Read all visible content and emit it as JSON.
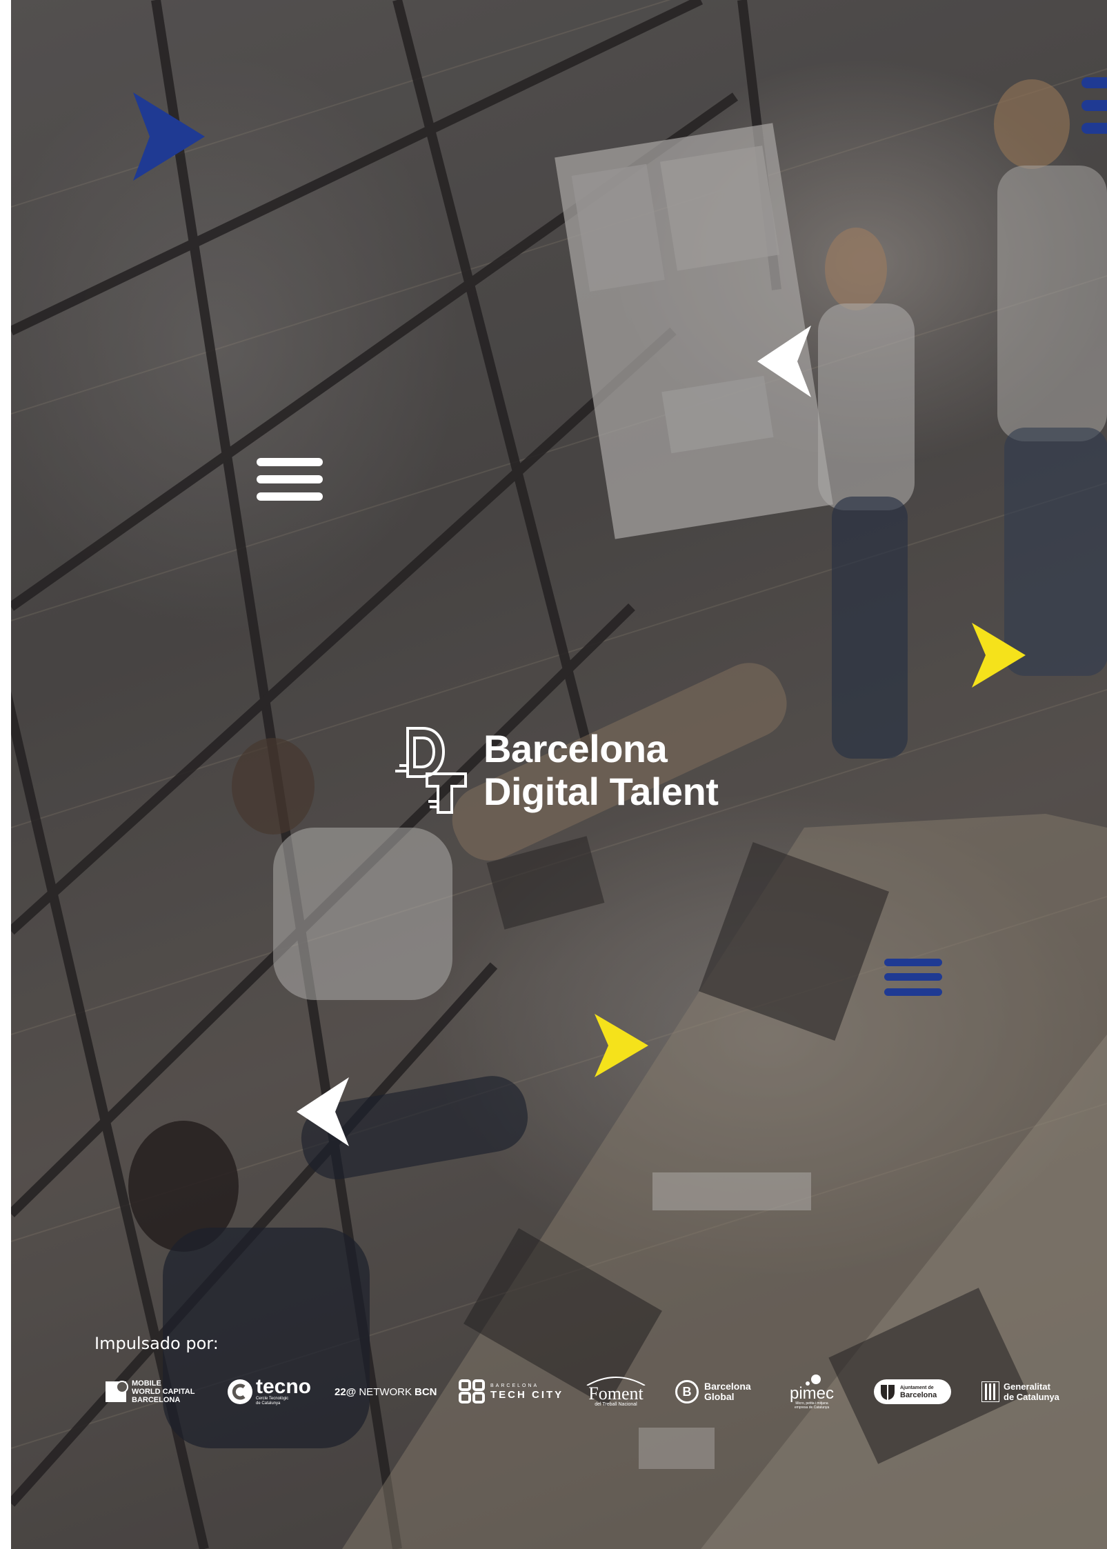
{
  "brand": {
    "title_line1": "Barcelona",
    "title_line2": "Digital Talent",
    "monogram_icon": "dt-monogram-icon"
  },
  "footer": {
    "label": "Impulsado por:",
    "partners": [
      {
        "name_line1": "MOBILE",
        "name_line2": "WORLD CAPITAL",
        "name_line3": "BARCELONA"
      },
      {
        "name": "tecno",
        "subtitle_line1": "Cercle Tecnològic",
        "subtitle_line2": "de Catalunya"
      },
      {
        "prefix": "22@",
        "middle": "NETWORK",
        "suffix": "BCN"
      },
      {
        "name_line1": "BARCELONA",
        "name_line2": "TECH CITY"
      },
      {
        "name": "Foment",
        "subtitle": "del Treball Nacional"
      },
      {
        "badge": "B",
        "name_line1": "Barcelona",
        "name_line2": "Global"
      },
      {
        "name": "pimec",
        "subtitle_line1": "Micro, petita i mitjana",
        "subtitle_line2": "empresa de Catalunya"
      },
      {
        "name_line1": "Ajuntament de",
        "name_line2": "Barcelona"
      },
      {
        "name_line1": "Generalitat",
        "name_line2": "de Catalunya"
      }
    ]
  },
  "colors": {
    "blue": "#1f3a93",
    "yellow": "#f5e21b",
    "white": "#ffffff"
  },
  "decorations": [
    "chevron-right-blue-icon",
    "menu-lines-blue-icon",
    "chevron-left-white-icon",
    "menu-lines-white-icon",
    "chevron-right-yellow-icon",
    "menu-lines-blue-icon",
    "chevron-right-yellow-icon",
    "chevron-left-white-icon"
  ]
}
